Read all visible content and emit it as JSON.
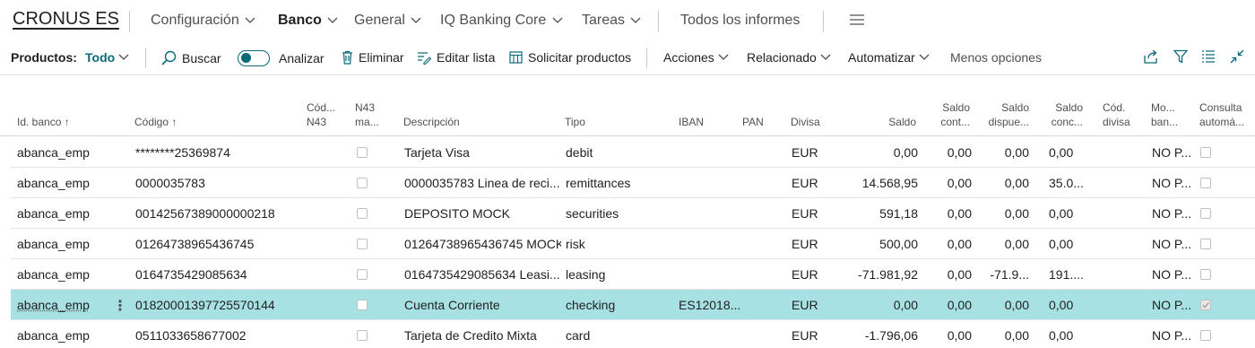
{
  "topnav": {
    "brand": "CRONUS ES",
    "items": [
      "Configuración",
      "Banco",
      "General",
      "IQ Banking Core",
      "Tareas"
    ],
    "reports": "Todos los informes"
  },
  "actionbar": {
    "productos_label": "Productos:",
    "filter_value": "Todo",
    "buscar": "Buscar",
    "analizar": "Analizar",
    "eliminar": "Eliminar",
    "editar_lista": "Editar lista",
    "solicitar": "Solicitar productos",
    "acciones": "Acciones",
    "relacionado": "Relacionado",
    "automatizar": "Automatizar",
    "menos": "Menos opciones"
  },
  "columns": {
    "id_banco": "Id. banco ↑",
    "codigo": "Código ↑",
    "cod_n43_1": "Cód...",
    "cod_n43_2": "N43",
    "n43_ma_1": "N43",
    "n43_ma_2": "ma...",
    "descripcion": "Descripción",
    "tipo": "Tipo",
    "iban": "IBAN",
    "pan": "PAN",
    "divisa": "Divisa",
    "saldo": "Saldo",
    "saldo_cont_1": "Saldo",
    "saldo_cont_2": "cont...",
    "saldo_disp_1": "Saldo",
    "saldo_disp_2": "dispue...",
    "saldo_conc_1": "Saldo",
    "saldo_conc_2": "conc...",
    "cod_divisa_1": "Cód.",
    "cod_divisa_2": "divisa",
    "mo_ban_1": "Mo...",
    "mo_ban_2": "ban...",
    "consulta_1": "Consulta",
    "consulta_2": "automá..."
  },
  "rows": [
    {
      "id": "abanca_emp",
      "codigo": "********25369874",
      "descripcion": "Tarjeta Visa",
      "tipo": "debit",
      "iban": "",
      "divisa": "EUR",
      "saldo": "0,00",
      "saldo_cont": "0,00",
      "saldo_disp": "0,00",
      "saldo_conc": "0,00",
      "mo_ban": "NO P...",
      "consulta": false
    },
    {
      "id": "abanca_emp",
      "codigo": "0000035783",
      "descripcion": "0000035783 Linea de reci...",
      "tipo": "remittances",
      "iban": "",
      "divisa": "EUR",
      "saldo": "14.568,95",
      "saldo_cont": "0,00",
      "saldo_disp": "0,00",
      "saldo_conc": "35.0...",
      "mo_ban": "NO P...",
      "consulta": false
    },
    {
      "id": "abanca_emp",
      "codigo": "00142567389000000218",
      "descripcion": "DEPOSITO MOCK",
      "tipo": "securities",
      "iban": "",
      "divisa": "EUR",
      "saldo": "591,18",
      "saldo_cont": "0,00",
      "saldo_disp": "0,00",
      "saldo_conc": "0,00",
      "mo_ban": "NO P...",
      "consulta": false
    },
    {
      "id": "abanca_emp",
      "codigo": "01264738965436745",
      "descripcion": "01264738965436745 MOCK",
      "tipo": "risk",
      "iban": "",
      "divisa": "EUR",
      "saldo": "500,00",
      "saldo_cont": "0,00",
      "saldo_disp": "0,00",
      "saldo_conc": "0,00",
      "mo_ban": "NO P...",
      "consulta": false
    },
    {
      "id": "abanca_emp",
      "codigo": "0164735429085634",
      "descripcion": "0164735429085634 Leasi...",
      "tipo": "leasing",
      "iban": "",
      "divisa": "EUR",
      "saldo": "-71.981,92",
      "saldo_cont": "0,00",
      "saldo_disp": "-71.9...",
      "saldo_conc": "191....",
      "mo_ban": "NO P...",
      "consulta": false
    },
    {
      "id": "abanca_emp",
      "codigo": "01820001397725570144",
      "descripcion": "Cuenta Corriente",
      "tipo": "checking",
      "iban": "ES12018...",
      "divisa": "EUR",
      "saldo": "0,00",
      "saldo_cont": "0,00",
      "saldo_disp": "0,00",
      "saldo_conc": "0,00",
      "mo_ban": "NO P...",
      "consulta": true
    },
    {
      "id": "abanca_emp",
      "codigo": "0511033658677002",
      "descripcion": "Tarjeta de Credito Mixta",
      "tipo": "card",
      "iban": "",
      "divisa": "EUR",
      "saldo": "-1.796,06",
      "saldo_cont": "0,00",
      "saldo_disp": "0,00",
      "saldo_conc": "0,00",
      "mo_ban": "NO P...",
      "consulta": false
    }
  ],
  "selected_row": 5,
  "colors": {
    "accent": "#0b6a78",
    "selected_row": "#a7e1e3"
  }
}
